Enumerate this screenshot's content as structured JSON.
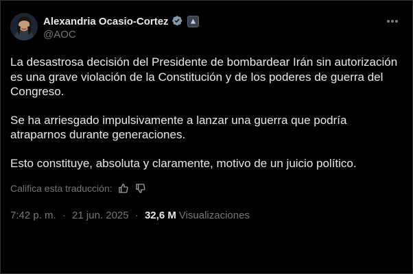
{
  "author": {
    "name": "Alexandria Ocasio-Cortez",
    "handle": "@AOC",
    "verified_icon": "verified-badge-icon",
    "affiliation_icon": "government-badge-icon"
  },
  "menu_icon": "more-options-icon",
  "tweet": {
    "paragraphs": [
      "La desastrosa decisión del Presidente de bombardear Irán sin autorización es una grave violación de la Constitución y de los poderes de guerra del Congreso.",
      "Se ha arriesgado impulsivamente a lanzar una guerra que podría atraparnos durante generaciones.",
      "Esto constituye, absoluta y claramente, motivo de un juicio político."
    ]
  },
  "translation": {
    "rate_label": "Califica esta traducción:",
    "like_icon": "thumbs-up-icon",
    "dislike_icon": "thumbs-down-icon"
  },
  "meta": {
    "time": "7:42 p. m.",
    "separator": "·",
    "date": "21 jun. 2025",
    "views_count": "32,6 M",
    "views_label": "Visualizaciones"
  },
  "colors": {
    "background": "#000000",
    "text": "#e7e9ea",
    "muted": "#71767b",
    "verified": "#829aab",
    "border": "#2f3336"
  }
}
